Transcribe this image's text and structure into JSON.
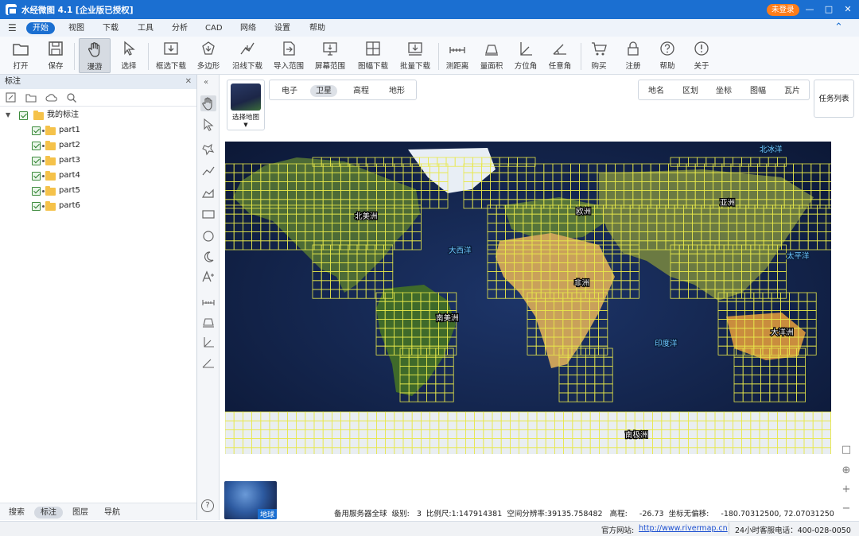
{
  "window": {
    "title": "水经微图 4.1 [企业版已授权]",
    "login_label": "未登录",
    "menu_icon": "menu-icon",
    "controls": [
      "minimize-icon",
      "restore-icon",
      "close-icon"
    ]
  },
  "menubar": {
    "tabs": [
      "开始",
      "视图",
      "下载",
      "工具",
      "分析",
      "CAD",
      "网络",
      "设置",
      "帮助"
    ],
    "active_tab": "开始"
  },
  "toolbar": {
    "items": [
      {
        "label": "打开",
        "icon": "folder-icon"
      },
      {
        "label": "保存",
        "icon": "save-icon"
      },
      {
        "label": "漫游",
        "icon": "hand-icon",
        "active": true
      },
      {
        "label": "选择",
        "icon": "cursor-icon"
      },
      {
        "label": "框选下载",
        "icon": "box-download-icon"
      },
      {
        "label": "多边形",
        "icon": "polygon-icon"
      },
      {
        "label": "沿线下载",
        "icon": "line-download-icon"
      },
      {
        "label": "导入范围",
        "icon": "import-icon"
      },
      {
        "label": "屏幕范围",
        "icon": "screen-icon"
      },
      {
        "label": "图幅下载",
        "icon": "sheet-icon"
      },
      {
        "label": "批量下载",
        "icon": "batch-icon"
      },
      {
        "label": "测距离",
        "icon": "ruler-icon"
      },
      {
        "label": "量面积",
        "icon": "area-icon"
      },
      {
        "label": "方位角",
        "icon": "azimuth-icon"
      },
      {
        "label": "任意角",
        "icon": "angle-icon"
      },
      {
        "label": "购买",
        "icon": "cart-icon"
      },
      {
        "label": "注册",
        "icon": "lock-icon"
      },
      {
        "label": "帮助",
        "icon": "help-icon"
      },
      {
        "label": "关于",
        "icon": "info-icon"
      }
    ]
  },
  "leftpanel": {
    "title": "标注",
    "close_icon": "close-icon",
    "tools": [
      "edit-icon",
      "open-folder-icon",
      "cloud-icon",
      "search-icon"
    ],
    "tree": {
      "root": "我的标注",
      "items": [
        "part1",
        "part2",
        "part3",
        "part4",
        "part5",
        "part6"
      ]
    },
    "bottom_tabs": [
      "搜索",
      "标注",
      "图层",
      "导航"
    ],
    "active_bottom_tab": "标注"
  },
  "mapctrl": {
    "select_map_label": "选择地图",
    "map_types": [
      "电子",
      "卫星",
      "高程",
      "地形"
    ],
    "active_map_type": "卫星",
    "overlays": [
      "地名",
      "区划",
      "坐标",
      "图幅",
      "瓦片"
    ],
    "tasks_label": "任务列表"
  },
  "map": {
    "labels": {
      "north_america": "北美洲",
      "europe": "欧洲",
      "asia": "亚洲",
      "atlantic": "大西洋",
      "pacific": "太平洋",
      "arctic": "北冰洋",
      "africa": "非洲",
      "south_america": "南美洲",
      "indian": "印度洋",
      "oceania": "大洋洲",
      "antarctica": "南极洲"
    },
    "grid_color": "#e8e84a",
    "globe_label": "地球"
  },
  "status": {
    "server": "备用服务器全球",
    "level_label": "级别:",
    "level": "3",
    "scale_label": "比例尺:",
    "scale": "1:147914381",
    "resolution_label": "空间分辨率:",
    "resolution": "39135.758482",
    "elevation_label": "高程:",
    "elevation": "-26.73",
    "coord_label": "坐标无偏移:",
    "coord": "-180.70312500, 72.07031250"
  },
  "footer": {
    "site_label": "官方网站:",
    "site_url": "http://www.rivermap.cn",
    "hotline": "24小时客服电话：400-028-0050"
  }
}
